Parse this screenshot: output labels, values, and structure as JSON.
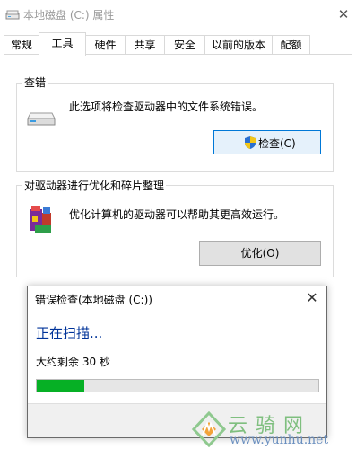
{
  "window": {
    "title": "本地磁盘 (C:) 属性",
    "close_glyph": "✕"
  },
  "tabs": [
    {
      "label": "常规",
      "active": false
    },
    {
      "label": "工具",
      "active": true
    },
    {
      "label": "硬件",
      "active": false
    },
    {
      "label": "共享",
      "active": false
    },
    {
      "label": "安全",
      "active": false
    },
    {
      "label": "以前的版本",
      "active": false
    },
    {
      "label": "配额",
      "active": false
    }
  ],
  "error_check": {
    "group_label": "查错",
    "description": "此选项将检查驱动器中的文件系统错误。",
    "button_label": "检查(C)",
    "icon": "drive-icon",
    "button_icon": "shield-icon"
  },
  "optimize": {
    "group_label": "对驱动器进行优化和碎片整理",
    "description": "优化计算机的驱动器可以帮助其更高效运行。",
    "button_label": "优化(O)",
    "icon": "defrag-icon"
  },
  "dialog": {
    "title": "错误检查(本地磁盘 (C:))",
    "close_glyph": "✕",
    "heading": "正在扫描...",
    "remaining": "大约剩余 30 秒",
    "progress_fraction": 0.17,
    "progress_color": "#06b025",
    "heading_color": "#003399"
  },
  "watermark": {
    "chinese": "云骑网",
    "url": "www.yunhu.net",
    "logo": "watermark-logo"
  }
}
